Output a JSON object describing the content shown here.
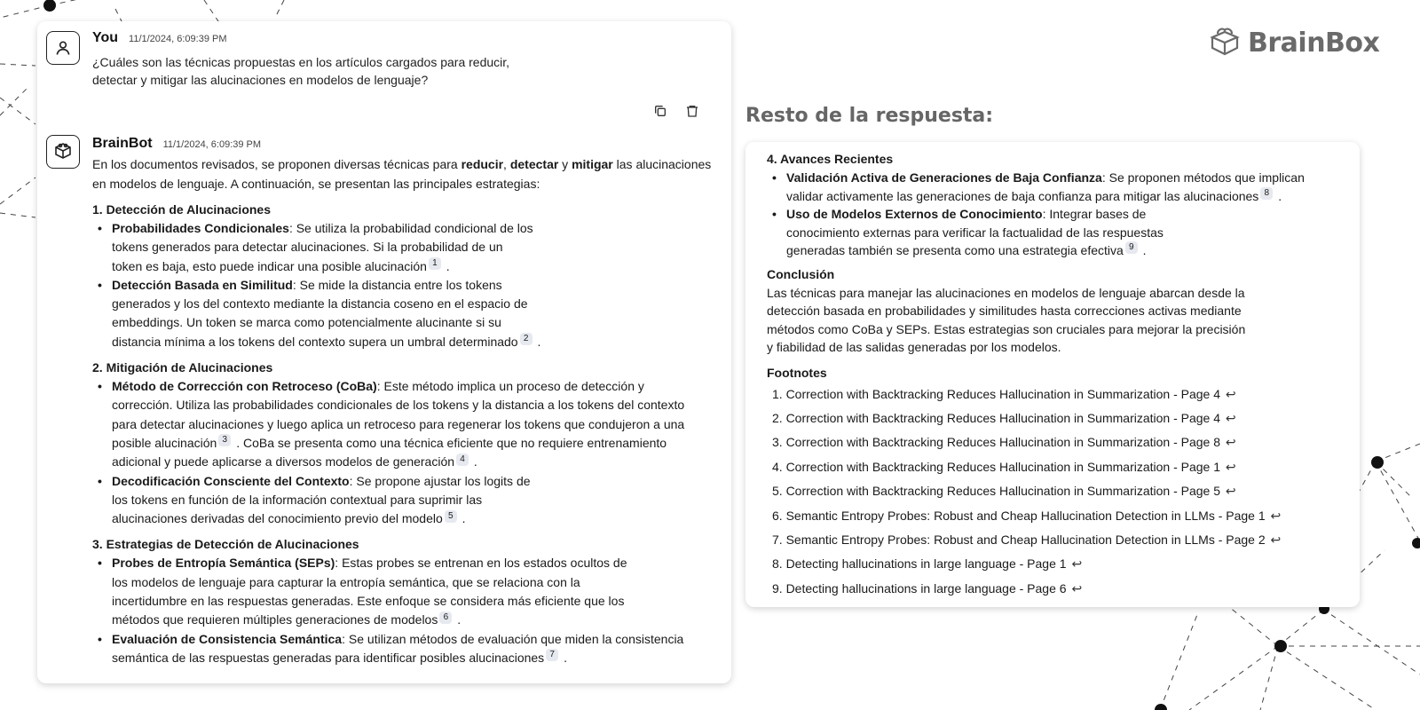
{
  "user_message": {
    "sender": "You",
    "timestamp": "11/1/2024, 6:09:39 PM",
    "text": "¿Cuáles son las técnicas propuestas en los artículos cargados para reducir, detectar y mitigar las alucinaciones en modelos de lenguaje?"
  },
  "actions": {
    "copy_icon": "copy-icon",
    "delete_icon": "trash-icon"
  },
  "bot_message": {
    "sender": "BrainBot",
    "timestamp": "11/1/2024, 6:09:39 PM",
    "intro_a": "En los documentos revisados, se proponen diversas técnicas para ",
    "intro_b1": "reducir",
    "intro_sep1": ", ",
    "intro_b2": "detectar",
    "intro_sep2": " y ",
    "intro_b3": "mitigar",
    "intro_c": " las alucinaciones en modelos de lenguaje. A continuación, se presentan las principales estrategias:",
    "sections": [
      {
        "title": "1. Detección de Alucinaciones",
        "items": [
          {
            "term": "Probabilidades Condicionales",
            "text": ": Se utiliza la probabilidad condicional de los tokens generados para detectar alucinaciones. Si la probabilidad de un token es baja, esto puede indicar una posible alucinación",
            "fn": "1",
            "tail": " ."
          },
          {
            "term": "Detección Basada en Similitud",
            "text": ": Se mide la distancia entre los tokens generados y los del contexto mediante la distancia coseno en el espacio de embeddings. Un token se marca como potencialmente alucinante si su distancia mínima a los tokens del contexto supera un umbral determinado",
            "fn": "2",
            "tail": " ."
          }
        ]
      },
      {
        "title": "2. Mitigación de Alucinaciones",
        "items": [
          {
            "term": "Método de Corrección con Retroceso (CoBa)",
            "text": ": Este método implica un proceso de detección y corrección. Utiliza las probabilidades condicionales de los tokens y la distancia a los tokens del contexto para detectar alucinaciones y luego aplica un retroceso para regenerar los tokens que condujeron a una posible alucinación",
            "fn": "3",
            "mid": " . CoBa se presenta como una técnica eficiente que no requiere entrenamiento adicional y puede aplicarse a diversos modelos de generación",
            "fn2": "4",
            "tail": " ."
          },
          {
            "term": "Decodificación Consciente del Contexto",
            "text": ": Se propone ajustar los logits de los tokens en función de la información contextual para suprimir las alucinaciones derivadas del conocimiento previo del modelo",
            "fn": "5",
            "tail": " ."
          }
        ]
      },
      {
        "title": "3. Estrategias de Detección de Alucinaciones",
        "items": [
          {
            "term": "Probes de Entropía Semántica (SEPs)",
            "text": ": Estas probes se entrenan en los estados ocultos de los modelos de lenguaje para capturar la entropía semántica, que se relaciona con la incertidumbre en las respuestas generadas. Este enfoque se considera más eficiente que los métodos que requieren múltiples generaciones de modelos",
            "fn": "6",
            "tail": " ."
          },
          {
            "term": "Evaluación de Consistencia Semántica",
            "text": ": Se utilizan métodos de evaluación que miden la consistencia semántica de las respuestas generadas para identificar posibles alucinaciones",
            "fn": "7",
            "tail": " ."
          }
        ]
      }
    ]
  },
  "logo": {
    "text": "BrainBox",
    "icon": "brain-box-icon"
  },
  "rest": {
    "title": "Resto de la respuesta:",
    "section_title": "4. Avances Recientes",
    "items": [
      {
        "term": "Validación Activa de Generaciones de Baja Confianza",
        "text": ": Se proponen métodos que implican validar activamente las generaciones de baja confianza para mitigar las alucinaciones",
        "fn": "8",
        "tail": " ."
      },
      {
        "term": "Uso de Modelos Externos de Conocimiento",
        "text": ": Integrar bases de conocimiento externas para verificar la factualidad de las respuestas generadas también se presenta como una estrategia efectiva",
        "fn": "9",
        "tail": " ."
      }
    ],
    "conclusion_title": "Conclusión",
    "conclusion_text": "Las técnicas para manejar las alucinaciones en modelos de lenguaje abarcan desde la detección basada en probabilidades y similitudes hasta correcciones activas mediante métodos como CoBa y SEPs. Estas estrategias son cruciales para mejorar la precisión y fiabilidad de las salidas generadas por los modelos.",
    "footnotes_title": "Footnotes",
    "footnotes": [
      "1. Correction with Backtracking Reduces Hallucination in Summarization - Page 4",
      "2. Correction with Backtracking Reduces Hallucination in Summarization - Page 4",
      "3. Correction with Backtracking Reduces Hallucination in Summarization - Page 8",
      "4. Correction with Backtracking Reduces Hallucination in Summarization - Page 1",
      "5. Correction with Backtracking Reduces Hallucination in Summarization - Page 5",
      "6. Semantic Entropy Probes: Robust and Cheap Hallucination Detection in LLMs - Page 1",
      "7. Semantic Entropy Probes: Robust and Cheap Hallucination Detection in LLMs - Page 2",
      "8. Detecting hallucinations in large language - Page 1",
      "9. Detecting hallucinations in large language - Page 6"
    ],
    "back_arrow": "↩"
  }
}
